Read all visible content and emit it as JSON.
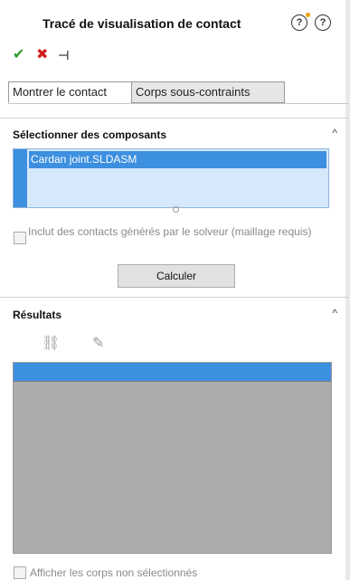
{
  "header": {
    "title": "Tracé de visualisation de contact",
    "help1_icon": "help-whats-new-icon",
    "help2_icon": "help-icon",
    "help_glyph": "?"
  },
  "actions": {
    "ok_icon": "check-icon",
    "cancel_icon": "close-icon",
    "pin_icon": "pin-icon",
    "ok_glyph": "✔",
    "cancel_glyph": "✖",
    "pin_glyph": "⊣"
  },
  "tabs": [
    {
      "label": "Montrer le contact",
      "active": true
    },
    {
      "label": "Corps sous-contraints",
      "active": false
    }
  ],
  "select_section": {
    "title": "Sélectionner des composants",
    "chevron": "^",
    "items": [
      "Cardan joint.SLDASM"
    ],
    "solver_checkbox_label": "Inclut des contacts générés par le solveur (maillage requis)",
    "calculate_label": "Calculer"
  },
  "results_section": {
    "title": "Résultats",
    "chevron": "^",
    "tool1_icon": "component-list-icon",
    "tool2_icon": "edit-icon",
    "tool1_glyph": "⛓",
    "tool2_glyph": "✎",
    "show_unselected_label": "Afficher les corps non sélectionnés"
  },
  "colors": {
    "selection_blue": "#3d8fe0",
    "list_bg": "#d6e8fb",
    "results_bg": "#ababab",
    "ok_green": "#2e9a2e",
    "cancel_red": "#d21f1f"
  }
}
